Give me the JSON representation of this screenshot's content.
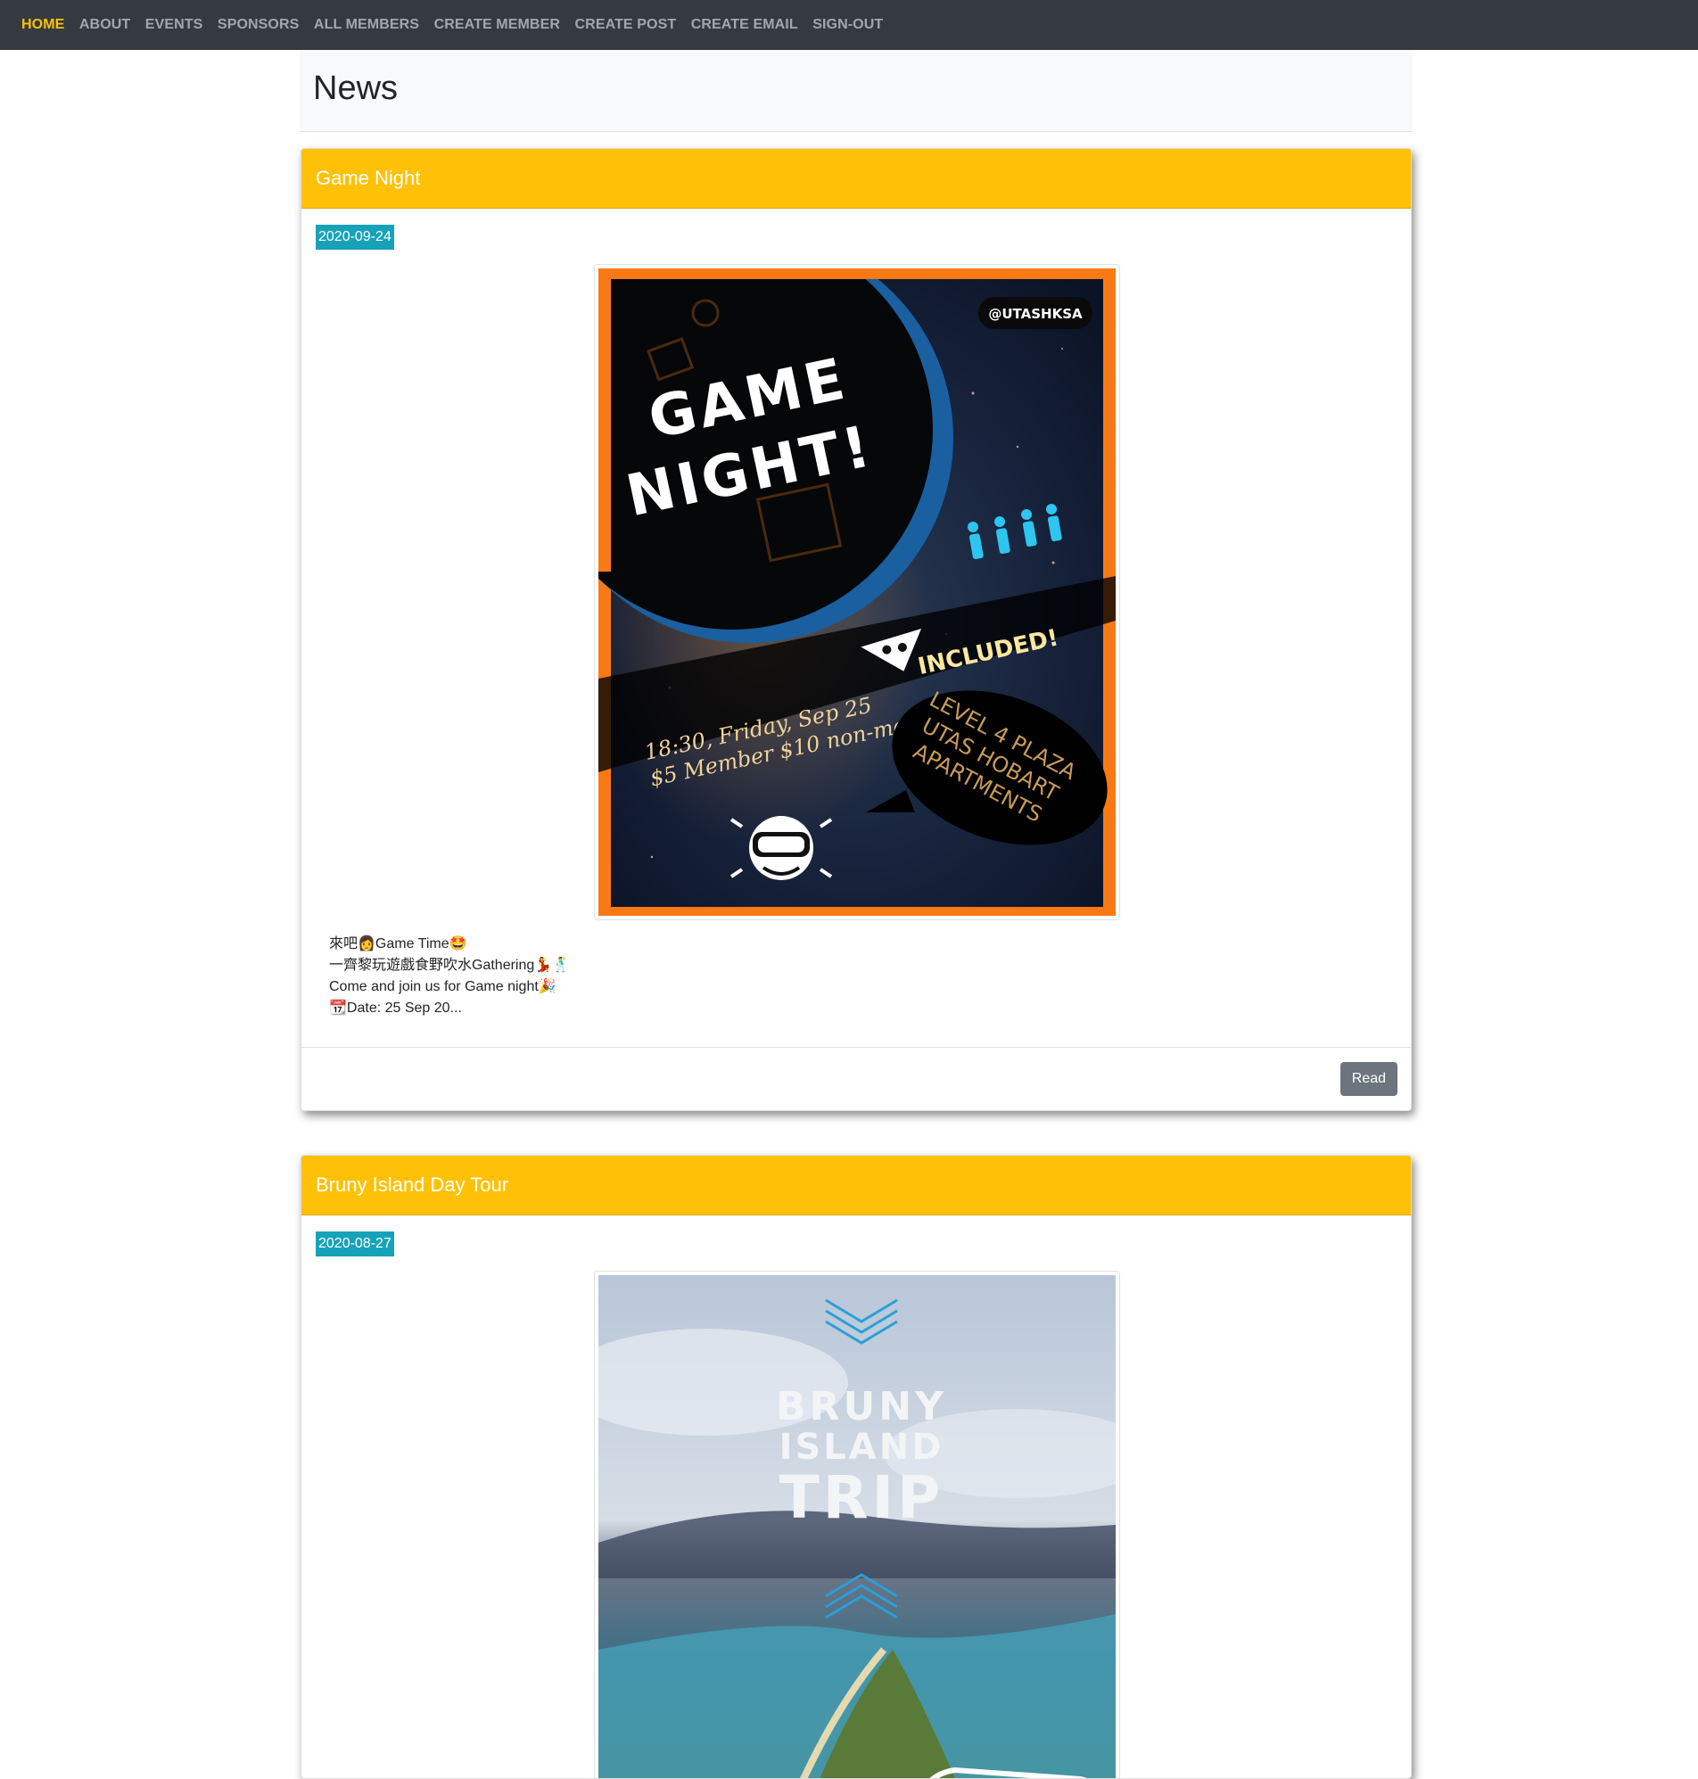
{
  "nav": {
    "items": [
      {
        "label": "HOME",
        "active": true
      },
      {
        "label": "ABOUT",
        "active": false
      },
      {
        "label": "EVENTS",
        "active": false
      },
      {
        "label": "SPONSORS",
        "active": false
      },
      {
        "label": "ALL MEMBERS",
        "active": false
      },
      {
        "label": "CREATE MEMBER",
        "active": false
      },
      {
        "label": "CREATE POST",
        "active": false
      },
      {
        "label": "CREATE EMAIL",
        "active": false
      },
      {
        "label": "SIGN-OUT",
        "active": false
      }
    ],
    "active_color": "#ffc107"
  },
  "page": {
    "title": "News"
  },
  "posts": [
    {
      "title": "Game Night",
      "date": "2020-09-24",
      "poster": {
        "handle": "@UTASHKSA",
        "headline_line1": "GAME",
        "headline_line2": "NIGHT!",
        "included": "INCLUDED!",
        "details_line1": "18:30, Friday, Sep 25",
        "details_line2": "$5 Member $10 non-member",
        "venue_line1": "LEVEL 4 PLAZA",
        "venue_line2": "UTAS HOBART",
        "venue_line3": "APARTMENTS"
      },
      "excerpt": [
        "來吧👩Game Time🤩",
        "一齊黎玩遊戲食野吹水Gathering💃🕺",
        "Come and join us for Game night🎉",
        "📆Date: 25 Sep 20..."
      ],
      "read_label": "Read"
    },
    {
      "title": "Bruny Island Day Tour",
      "date": "2020-08-27",
      "poster": {
        "line1": "BRUNY",
        "line2": "ISLAND",
        "line3": "TRIP"
      }
    }
  ],
  "colors": {
    "navbar": "#343a40",
    "card_header": "#ffc107",
    "badge": "#17a2b8",
    "button": "#6c757d"
  }
}
